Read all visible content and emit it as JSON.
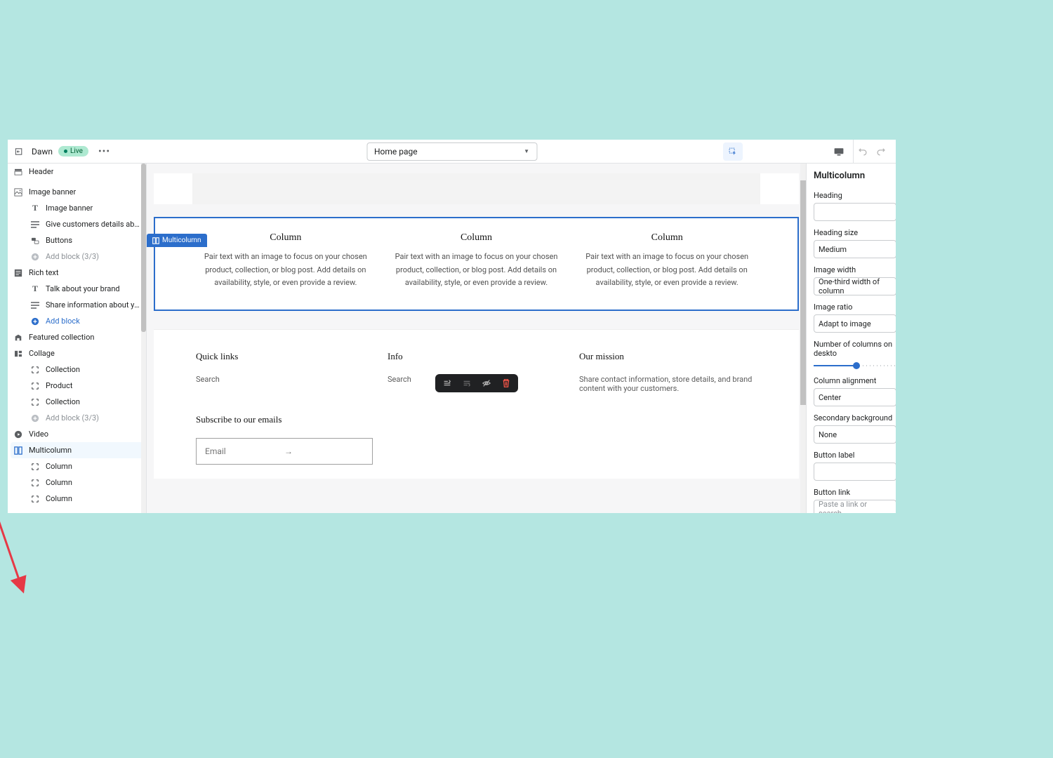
{
  "topbar": {
    "theme_name": "Dawn",
    "live_label": "Live",
    "page_selector": "Home page"
  },
  "sidebar": {
    "header": "Header",
    "image_banner": {
      "label": "Image banner",
      "children": [
        "Image banner",
        "Give customers details about ...",
        "Buttons"
      ],
      "add_block": "Add block (3/3)"
    },
    "rich_text": {
      "label": "Rich text",
      "children": [
        "Talk about your brand",
        "Share information about your..."
      ],
      "add_block": "Add block"
    },
    "featured_collection": "Featured collection",
    "collage": {
      "label": "Collage",
      "children": [
        "Collection",
        "Product",
        "Collection"
      ],
      "add_block": "Add block (3/3)"
    },
    "video": "Video",
    "multicolumn": {
      "label": "Multicolumn",
      "children": [
        "Column",
        "Column",
        "Column"
      ]
    }
  },
  "preview": {
    "section_tag": "Multicolumn",
    "columns": [
      {
        "title": "Column",
        "body": "Pair text with an image to focus on your chosen product, collection, or blog post. Add details on availability, style, or even provide a review."
      },
      {
        "title": "Column",
        "body": "Pair text with an image to focus on your chosen product, collection, or blog post. Add details on availability, style, or even provide a review."
      },
      {
        "title": "Column",
        "body": "Pair text with an image to focus on your chosen product, collection, or blog post. Add details on availability, style, or even provide a review."
      }
    ],
    "footer": {
      "quick_links": {
        "title": "Quick links",
        "link": "Search"
      },
      "info": {
        "title": "Info",
        "link": "Search"
      },
      "mission": {
        "title": "Our mission",
        "body": "Share contact information, store details, and brand content with your customers."
      }
    },
    "subscribe": {
      "title": "Subscribe to our emails",
      "placeholder": "Email"
    }
  },
  "settings": {
    "title": "Multicolumn",
    "heading_label": "Heading",
    "heading_value": "",
    "heading_size_label": "Heading size",
    "heading_size_value": "Medium",
    "image_width_label": "Image width",
    "image_width_value": "One-third width of column",
    "image_ratio_label": "Image ratio",
    "image_ratio_value": "Adapt to image",
    "columns_label": "Number of columns on deskto",
    "alignment_label": "Column alignment",
    "alignment_value": "Center",
    "secondary_bg_label": "Secondary background",
    "secondary_bg_value": "None",
    "button_label_label": "Button label",
    "button_label_value": "",
    "button_link_label": "Button link",
    "button_link_placeholder": "Paste a link or search"
  }
}
